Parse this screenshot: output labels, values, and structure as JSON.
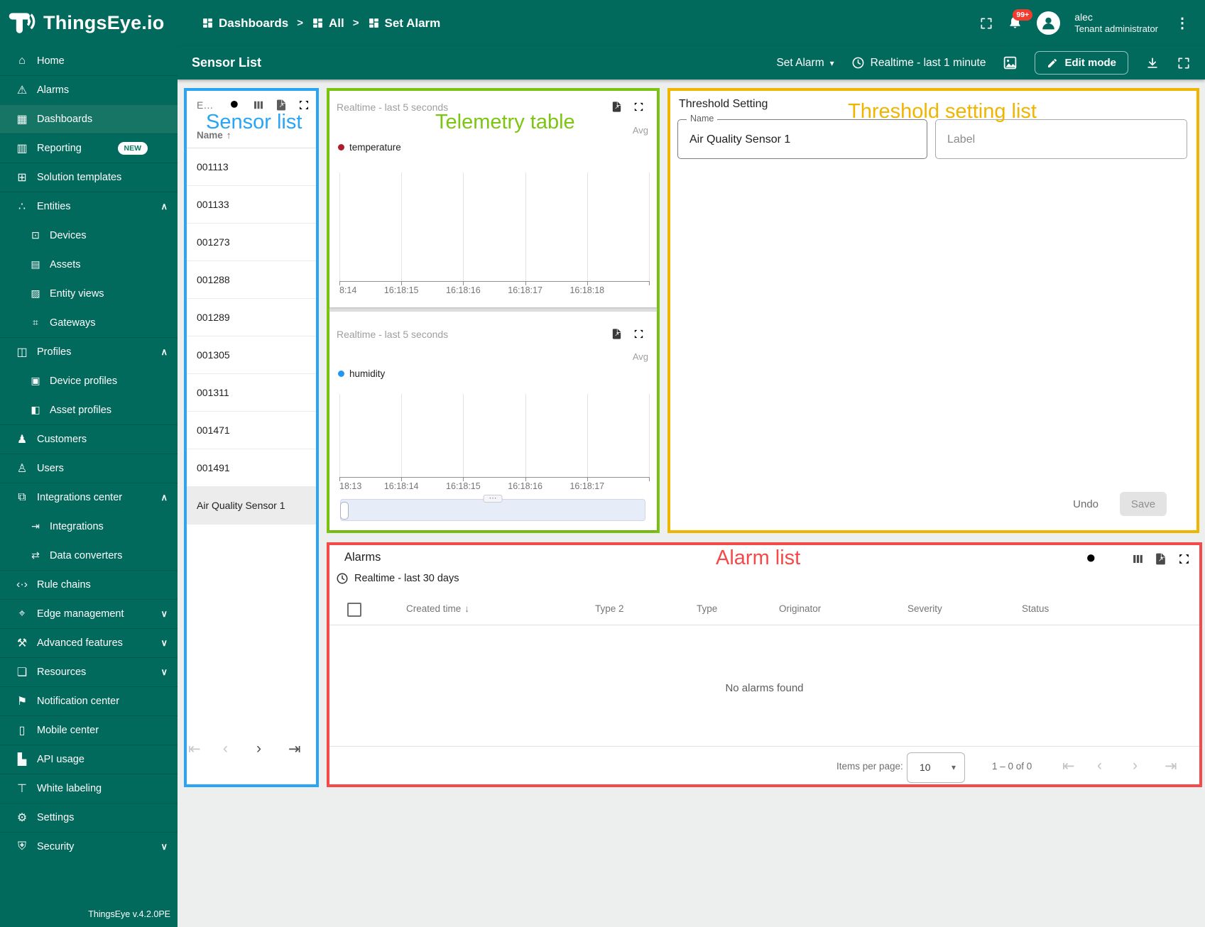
{
  "app": {
    "brand": "ThingsEye.io",
    "version": "ThingsEye v.4.2.0PE"
  },
  "colors": {
    "sidebar": "#02695d",
    "annotation_blue": "#2aa4f4",
    "annotation_green": "#7cc511",
    "annotation_amber": "#f0b500",
    "annotation_red": "#f44a4a",
    "temperature_series": "#b01c2e",
    "humidity_series": "#2196f3"
  },
  "icons": {
    "home": "⌂",
    "alarms": "⚠",
    "dashboards": "▦",
    "reporting": "▥",
    "solution-templates": "⊞",
    "entities": "∴",
    "devices": "⊡",
    "assets": "▤",
    "entity-views": "▨",
    "gateways": "⌗",
    "profiles": "◫",
    "device-profiles": "▣",
    "asset-profiles": "◧",
    "customers": "♟",
    "users": "♙",
    "integrations-center": "⧉",
    "integrations": "⇥",
    "data-converters": "⇄",
    "rule-chains": "‹·›",
    "edge-management": "⌖",
    "advanced-features": "⚒",
    "resources": "❏",
    "notification-center": "⚑",
    "mobile-center": "▯",
    "api-usage": "▙",
    "white-labeling": "⊤",
    "settings": "⚙",
    "security": "⛨",
    "chevron-up": "∧",
    "chevron-down": "∨",
    "caret-down": "▾",
    "sort-asc": "↑",
    "sort-desc": "↓",
    "more-vertical": "⋮",
    "grip-dots": "⋯",
    "page-first": "⇤",
    "page-prev": "‹",
    "page-next": "›",
    "page-last": "⇥"
  },
  "header": {
    "breadcrumbs": [
      {
        "label": "Dashboards"
      },
      {
        "label": "All"
      },
      {
        "label": "Set Alarm"
      }
    ],
    "separator": ">",
    "notifications_badge": "99+",
    "user": {
      "name": "alec",
      "role": "Tenant administrator"
    }
  },
  "toolbar": {
    "title": "Sensor List",
    "state_button": "Set Alarm",
    "timewindow": "Realtime - last 1 minute",
    "edit_button": "Edit mode"
  },
  "sidebar": {
    "items": [
      {
        "label": "Home",
        "icon": "home",
        "level": 0
      },
      {
        "label": "Alarms",
        "icon": "alarms",
        "level": 0
      },
      {
        "label": "Dashboards",
        "icon": "dashboards",
        "level": 0,
        "active": true
      },
      {
        "label": "Reporting",
        "icon": "reporting",
        "level": 0,
        "badge": "NEW"
      },
      {
        "label": "Solution templates",
        "icon": "solution-templates",
        "level": 0
      },
      {
        "label": "Entities",
        "icon": "entities",
        "level": 0,
        "chevron": "up"
      },
      {
        "label": "Devices",
        "icon": "devices",
        "level": 1
      },
      {
        "label": "Assets",
        "icon": "assets",
        "level": 1
      },
      {
        "label": "Entity views",
        "icon": "entity-views",
        "level": 1
      },
      {
        "label": "Gateways",
        "icon": "gateways",
        "level": 1
      },
      {
        "label": "Profiles",
        "icon": "profiles",
        "level": 0,
        "chevron": "up"
      },
      {
        "label": "Device profiles",
        "icon": "device-profiles",
        "level": 1
      },
      {
        "label": "Asset profiles",
        "icon": "asset-profiles",
        "level": 1
      },
      {
        "label": "Customers",
        "icon": "customers",
        "level": 0
      },
      {
        "label": "Users",
        "icon": "users",
        "level": 0
      },
      {
        "label": "Integrations center",
        "icon": "integrations-center",
        "level": 0,
        "chevron": "up"
      },
      {
        "label": "Integrations",
        "icon": "integrations",
        "level": 1
      },
      {
        "label": "Data converters",
        "icon": "data-converters",
        "level": 1
      },
      {
        "label": "Rule chains",
        "icon": "rule-chains",
        "level": 0
      },
      {
        "label": "Edge management",
        "icon": "edge-management",
        "level": 0,
        "chevron": "down"
      },
      {
        "label": "Advanced features",
        "icon": "advanced-features",
        "level": 0,
        "chevron": "down"
      },
      {
        "label": "Resources",
        "icon": "resources",
        "level": 0,
        "chevron": "down"
      },
      {
        "label": "Notification center",
        "icon": "notification-center",
        "level": 0
      },
      {
        "label": "Mobile center",
        "icon": "mobile-center",
        "level": 0
      },
      {
        "label": "API usage",
        "icon": "api-usage",
        "level": 0
      },
      {
        "label": "White labeling",
        "icon": "white-labeling",
        "level": 0
      },
      {
        "label": "Settings",
        "icon": "settings",
        "level": 0
      },
      {
        "label": "Security",
        "icon": "security",
        "level": 0,
        "chevron": "down"
      }
    ]
  },
  "annotations": {
    "sensor_list": "Sensor list",
    "telemetry_table": "Telemetry table",
    "threshold_setting": "Threshold setting list",
    "alarm_list": "Alarm list"
  },
  "sensor_panel": {
    "title": "E…",
    "column_name": "Name",
    "rows": [
      "001113",
      "001133",
      "001273",
      "001288",
      "001289",
      "001305",
      "001311",
      "001471",
      "001491",
      "Air Quality Sensor 1"
    ],
    "selected_row": "Air Quality Sensor 1"
  },
  "telemetry_panel": {
    "charts": [
      {
        "timewindow": "Realtime - last 5 seconds",
        "aggregation": "Avg",
        "legend": "temperature",
        "x_ticks": [
          "8:14",
          "16:18:15",
          "16:18:16",
          "16:18:17",
          "16:18:18"
        ]
      },
      {
        "timewindow": "Realtime - last 5 seconds",
        "aggregation": "Avg",
        "legend": "humidity",
        "x_ticks": [
          "18:13",
          "16:18:14",
          "16:18:15",
          "16:18:16",
          "16:18:17"
        ]
      }
    ]
  },
  "chart_data": [
    {
      "type": "line",
      "title": "Realtime - last 5 seconds",
      "series": [
        {
          "name": "temperature",
          "color": "#b01c2e",
          "values": []
        }
      ],
      "x_tick_labels": [
        "8:14",
        "16:18:15",
        "16:18:16",
        "16:18:17",
        "16:18:18"
      ],
      "xlabel": "",
      "ylabel": "",
      "grid": "vertical-gridlines-only",
      "legend_position": "top-left",
      "aggregation": "Avg",
      "empty": true
    },
    {
      "type": "line",
      "title": "Realtime - last 5 seconds",
      "series": [
        {
          "name": "humidity",
          "color": "#2196f3",
          "values": []
        }
      ],
      "x_tick_labels": [
        "18:13",
        "16:18:14",
        "16:18:15",
        "16:18:16",
        "16:18:17"
      ],
      "xlabel": "",
      "ylabel": "",
      "grid": "vertical-gridlines-only",
      "legend_position": "top-left",
      "aggregation": "Avg",
      "empty": true
    }
  ],
  "threshold_panel": {
    "title": "Threshold Setting",
    "name_label": "Name",
    "name_value": "Air Quality Sensor 1",
    "label_placeholder": "Label",
    "undo": "Undo",
    "save": "Save"
  },
  "alarms_panel": {
    "title": "Alarms",
    "timewindow": "Realtime - last 30 days",
    "columns": [
      "Created time",
      "Type 2",
      "Type",
      "Originator",
      "Severity",
      "Status"
    ],
    "sorted_column": "Created time",
    "empty_message": "No alarms found",
    "footer": {
      "items_per_page_label": "Items per page:",
      "items_per_page": "10",
      "range": "1 – 0 of 0"
    }
  }
}
